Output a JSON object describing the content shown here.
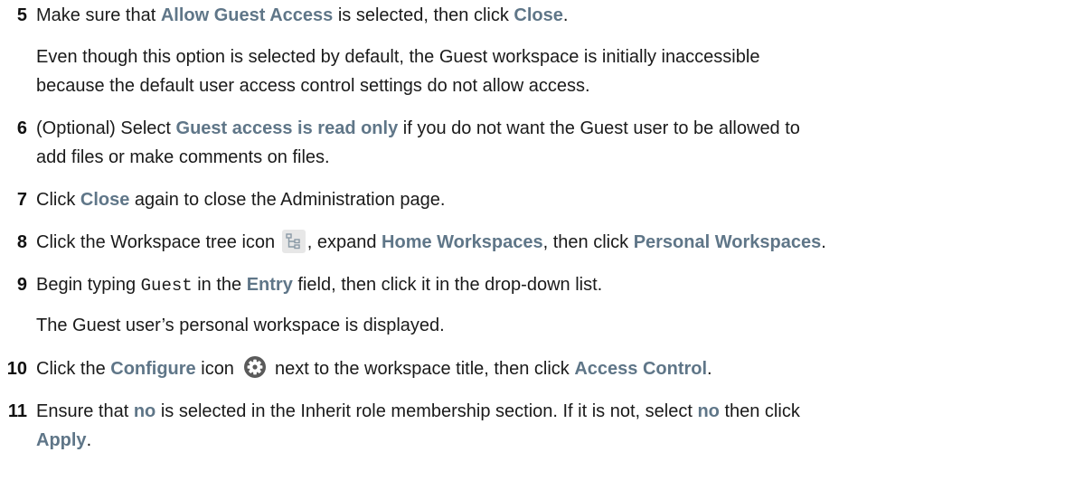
{
  "steps": [
    {
      "num": "5",
      "parts": [
        "Make sure that ",
        "Allow Guest Access",
        " is selected, then click ",
        "Close",
        "."
      ],
      "note_lines": [
        "Even though this option is selected by default, the Guest workspace is initially inaccessible",
        "because the default user access control settings do not allow access."
      ]
    },
    {
      "num": "6",
      "line1": [
        "(Optional) Select ",
        "Guest access is read only",
        " if you do not want the Guest user to be allowed to"
      ],
      "line2": "add files or make comments on files."
    },
    {
      "num": "7",
      "parts": [
        "Click ",
        "Close",
        " again to close the Administration page."
      ]
    },
    {
      "num": "8",
      "parts": [
        "Click the Workspace tree icon ",
        ", expand ",
        "Home Workspaces",
        ", then click ",
        "Personal Workspaces",
        "."
      ],
      "icon": "workspace-tree-icon"
    },
    {
      "num": "9",
      "parts": [
        "Begin typing ",
        "Guest",
        " in the ",
        "Entry",
        " field, then click it in the drop-down list."
      ],
      "note": "The Guest user’s personal workspace is displayed."
    },
    {
      "num": "10",
      "parts": [
        "Click the ",
        "Configure",
        " icon ",
        " next to the workspace title, then click ",
        "Access Control",
        "."
      ],
      "icon": "gear-icon"
    },
    {
      "num": "11",
      "line1": [
        "Ensure that ",
        "no",
        " is selected in the Inherit role membership section. If it is not, select ",
        "no",
        " then click"
      ],
      "line2": [
        "Apply",
        "."
      ]
    }
  ],
  "colors": {
    "ui_term": "#5f7688",
    "text": "#1a1a1a"
  }
}
